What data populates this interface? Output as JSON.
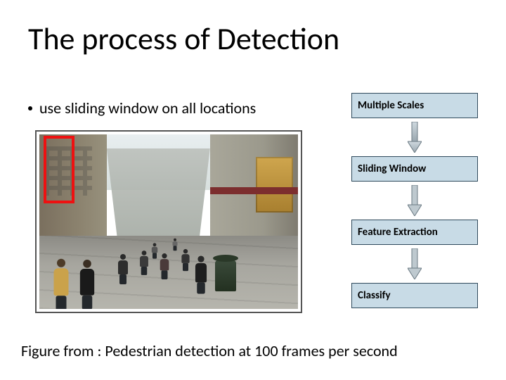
{
  "title": "The process of Detection",
  "bullet_text": "use sliding window on all locations",
  "flow": {
    "steps": [
      "Multiple Scales",
      "Sliding Window",
      "Feature Extraction",
      "Classify"
    ]
  },
  "caption": "Figure  from : Pedestrian detection at 100 frames per second",
  "colors": {
    "flow_box_bg": "#c8dbe6",
    "flow_box_border": "#2f4a5c",
    "detection_box": "#e11"
  },
  "icons": {
    "bullet": "•",
    "down_arrow": "↓"
  }
}
